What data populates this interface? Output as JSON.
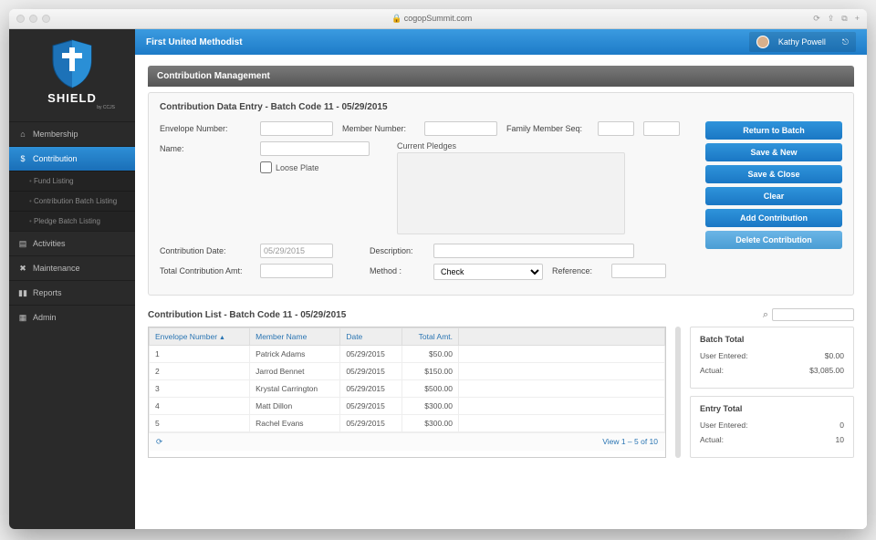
{
  "browser": {
    "url": "cogopSummit.com"
  },
  "logo": {
    "name": "SHIELD",
    "sub": "by CCJS"
  },
  "sidebar": {
    "items": [
      {
        "icon": "home",
        "label": "Membership"
      },
      {
        "icon": "dollar",
        "label": "Contribution"
      },
      {
        "icon": "cal",
        "label": "Activities"
      },
      {
        "icon": "wrench",
        "label": "Maintenance"
      },
      {
        "icon": "chart",
        "label": "Reports"
      },
      {
        "icon": "grid",
        "label": "Admin"
      }
    ],
    "sub": [
      {
        "label": "Fund Listing"
      },
      {
        "label": "Contribution Batch Listing"
      },
      {
        "label": "Pledge Batch Listing"
      }
    ]
  },
  "topbar": {
    "org": "First United Methodist",
    "user": "Kathy Powell"
  },
  "section": {
    "title": "Contribution Management"
  },
  "entry": {
    "title": "Contribution Data Entry - Batch Code 11 - 05/29/2015",
    "labels": {
      "envelope": "Envelope Number:",
      "member": "Member Number:",
      "famseq": "Family Member Seq:",
      "name": "Name:",
      "loose": "Loose Plate",
      "pledges": "Current Pledges",
      "cdate": "Contribution Date:",
      "desc": "Description:",
      "total": "Total Contribution Amt:",
      "method": "Method :",
      "reference": "Reference:"
    },
    "values": {
      "cdate": "05/29/2015",
      "method": "Check"
    },
    "buttons": {
      "return": "Return to Batch",
      "savenew": "Save & New",
      "saveclose": "Save & Close",
      "clear": "Clear",
      "add": "Add Contribution",
      "delete": "Delete Contribution"
    }
  },
  "list": {
    "title": "Contribution List - Batch Code 11 - 05/29/2015",
    "columns": {
      "env": "Envelope Number",
      "name": "Member Name",
      "date": "Date",
      "amt": "Total Amt."
    },
    "rows": [
      {
        "env": "1",
        "name": "Patrick Adams",
        "date": "05/29/2015",
        "amt": "$50.00"
      },
      {
        "env": "2",
        "name": "Jarrod Bennet",
        "date": "05/29/2015",
        "amt": "$150.00"
      },
      {
        "env": "3",
        "name": "Krystal Carrington",
        "date": "05/29/2015",
        "amt": "$500.00"
      },
      {
        "env": "4",
        "name": "Matt Dillon",
        "date": "05/29/2015",
        "amt": "$300.00"
      },
      {
        "env": "5",
        "name": "Rachel Evans",
        "date": "05/29/2015",
        "amt": "$300.00"
      }
    ],
    "footer": {
      "refresh": "⟳",
      "range": "View 1 – 5 of 10"
    }
  },
  "batch_total": {
    "title": "Batch Total",
    "user_entered_label": "User Entered:",
    "user_entered_value": "$0.00",
    "actual_label": "Actual:",
    "actual_value": "$3,085.00"
  },
  "entry_total": {
    "title": "Entry Total",
    "user_entered_label": "User Entered:",
    "user_entered_value": "0",
    "actual_label": "Actual:",
    "actual_value": "10"
  }
}
